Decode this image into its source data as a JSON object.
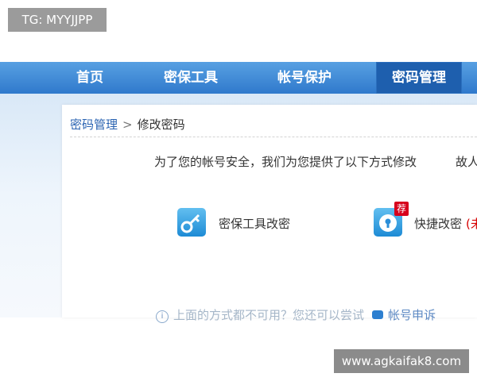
{
  "tg_badge": "TG: MYYJJPP",
  "nav": {
    "items": [
      {
        "label": "首页"
      },
      {
        "label": "密保工具"
      },
      {
        "label": "帐号保护"
      },
      {
        "label": "密码管理"
      }
    ],
    "active_index": 3
  },
  "breadcrumb": {
    "parent": "密码管理",
    "separator": ">",
    "current": "修改密码"
  },
  "intro": {
    "text": "为了您的帐号安全，我们为您提供了以下方式修改",
    "extra": "故人"
  },
  "options": [
    {
      "icon": "key-icon",
      "label": "密保工具改密"
    },
    {
      "icon": "lock-icon",
      "label": "快捷改密",
      "badge": "荐",
      "note": "(未"
    }
  ],
  "help": {
    "text": "上面的方式都不可用？您还可以尝试",
    "link": "帐号申诉"
  },
  "watermark": "www.agkaifak8.com"
}
